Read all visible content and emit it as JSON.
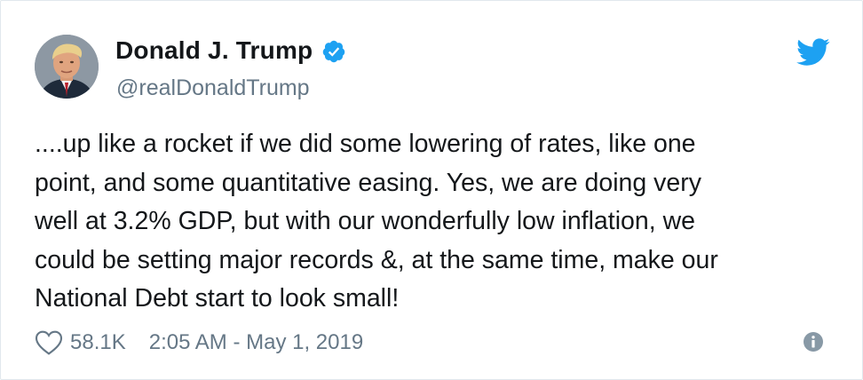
{
  "author": {
    "name": "Donald J. Trump",
    "handle": "@realDonaldTrump"
  },
  "tweet": {
    "lines": [
      "....up like a rocket if we did some lowering of rates, like one",
      "point, and some quantitative easing. Yes, we are doing very",
      "well at 3.2% GDP, but with our wonderfully low inflation, we",
      "could be setting major records &, at the same time, make our",
      "National Debt start to look small!"
    ]
  },
  "footer": {
    "like_count": "58.1K",
    "timestamp": "2:05 AM - May 1, 2019"
  },
  "icons": {
    "verified": "verified-badge-icon",
    "brand": "twitter-bird-icon",
    "like": "heart-icon",
    "info": "info-icon"
  },
  "colors": {
    "verified": "#1da1f2",
    "brand": "#1da1f2",
    "secondary_text": "#657786",
    "primary_text": "#14171a"
  }
}
